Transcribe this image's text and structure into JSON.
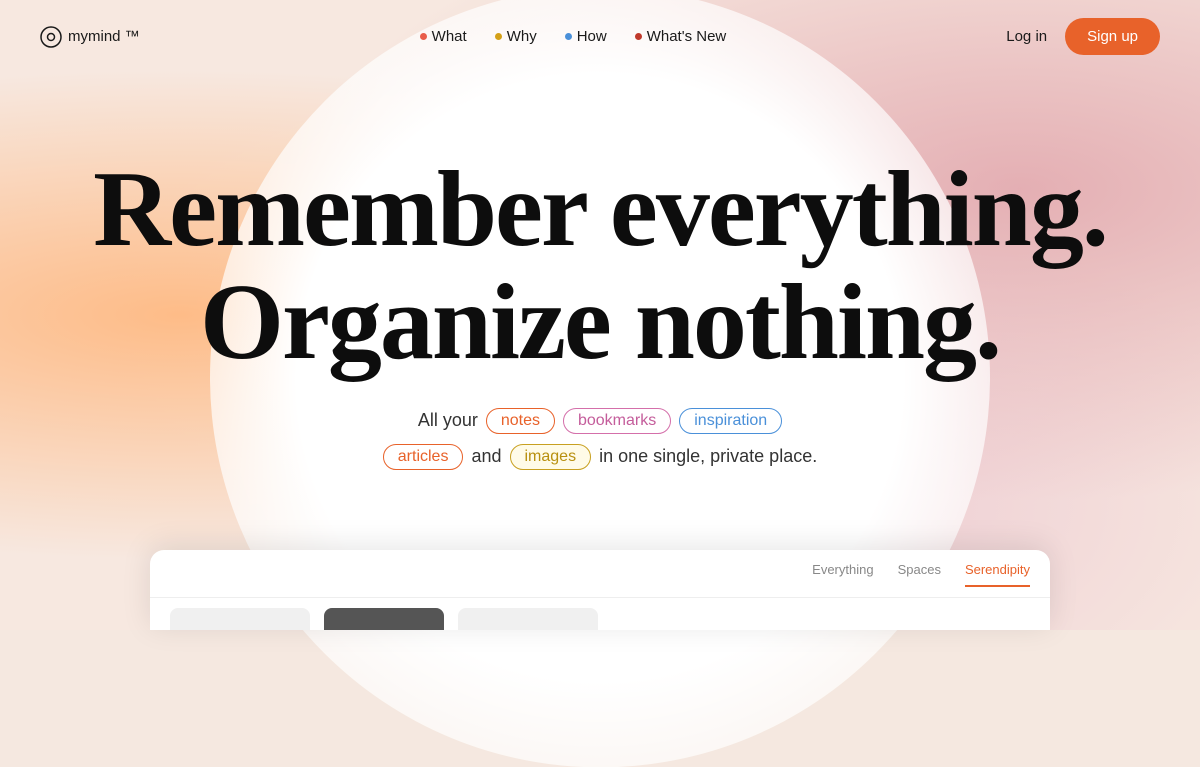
{
  "logo": {
    "text": "mymind ™"
  },
  "nav": {
    "items": [
      {
        "label": "What",
        "dot_color": "dot-red"
      },
      {
        "label": "Why",
        "dot_color": "dot-yellow"
      },
      {
        "label": "How",
        "dot_color": "dot-blue"
      },
      {
        "label": "What's New",
        "dot_color": "dot-pink"
      }
    ]
  },
  "header": {
    "login_label": "Log in",
    "signup_label": "Sign up"
  },
  "hero": {
    "line1": "Remember everything.",
    "line2": "Organize nothing.",
    "subtitle_prefix": "All your",
    "tags_line1": [
      "notes",
      "bookmarks",
      "inspiration"
    ],
    "tags_line2_prefix": "",
    "tags_line2": [
      "articles"
    ],
    "conjunction": "and",
    "tags_line2_b": [
      "images"
    ],
    "suffix": "in one single, private place."
  },
  "app_preview": {
    "tabs": [
      "Everything",
      "Spaces",
      "Serendipity"
    ],
    "active_tab": "Serendipity"
  },
  "colors": {
    "accent": "#e8622a",
    "background": "#f7e8e0"
  }
}
